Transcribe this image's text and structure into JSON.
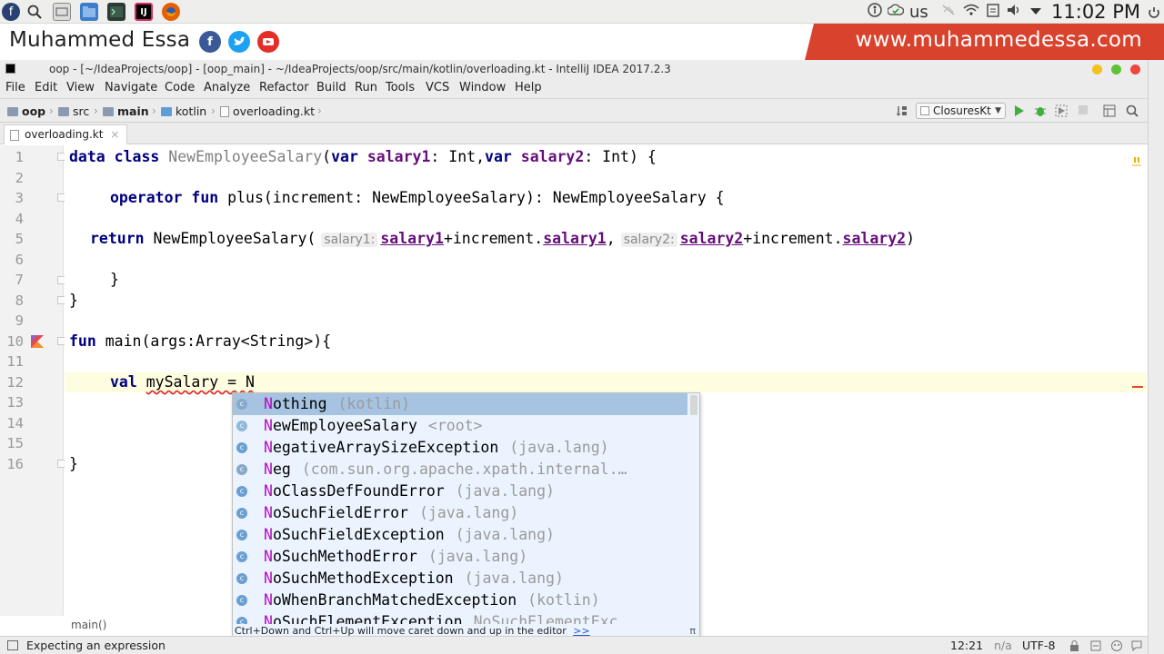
{
  "taskbar": {
    "keyboard_layout": "us",
    "clock": "11:02 PM",
    "launcher_icons": [
      "fedora-icon",
      "search-icon",
      "show-desktop-icon",
      "files-icon",
      "terminal-icon",
      "intellij-icon",
      "firefox-icon"
    ]
  },
  "banner": {
    "name": "Muhammed Essa",
    "website": "www.muhammedessa.com",
    "social": [
      "facebook-icon",
      "twitter-icon",
      "youtube-icon"
    ],
    "colors": {
      "accent": "#d9422d",
      "facebook": "#3b5998",
      "twitter": "#1da1f2",
      "youtube": "#e52d27"
    }
  },
  "window": {
    "title": "oop - [~/IdeaProjects/oop] - [oop_main] - ~/IdeaProjects/oop/src/main/kotlin/overloading.kt - IntelliJ IDEA 2017.2.3"
  },
  "menu": [
    "File",
    "Edit",
    "View",
    "Navigate",
    "Code",
    "Analyze",
    "Refactor",
    "Build",
    "Run",
    "Tools",
    "VCS",
    "Window",
    "Help"
  ],
  "breadcrumbs": [
    "oop",
    "src",
    "main",
    "kotlin",
    "overloading.kt"
  ],
  "run_config": "ClosuresKt",
  "tab": {
    "label": "overloading.kt",
    "close": "×"
  },
  "line_numbers": [
    "1",
    "2",
    "3",
    "4",
    "5",
    "6",
    "7",
    "8",
    "9",
    "10",
    "11",
    "12",
    "13",
    "14",
    "15",
    "16"
  ],
  "code": {
    "l1": {
      "kw1": "data class ",
      "name": "NewEmployeeSalary",
      "p1": "(",
      "kw2": "var ",
      "prop1": "salary1",
      "t1": ": Int,",
      "kw3": "var ",
      "prop2": "salary2",
      "t2": ": Int) {"
    },
    "l3": {
      "kw": "operator fun ",
      "rest": "plus(increment: NewEmployeeSalary): NewEmployeeSalary {"
    },
    "l5": {
      "kw": "return ",
      "call": "NewEmployeeSalary(",
      "hint1": "salary1:",
      "a1": "salary1",
      "a2": "+increment.",
      "a3": "salary1",
      "a4": ",",
      "hint2": "salary2:",
      "b1": "salary2",
      "b2": "+increment.",
      "b3": "salary2",
      "end": ")"
    },
    "l7": "}",
    "l8": "}",
    "l10": {
      "kw": "fun ",
      "rest": "main(args:Array<String>){"
    },
    "l12": {
      "kw": "val ",
      "rest": "mySalary = N"
    },
    "l16": "}"
  },
  "completion": {
    "items": [
      {
        "match": "N",
        "rest": "othing",
        "loc": "(kotlin)",
        "icon": "class-icon"
      },
      {
        "match": "N",
        "rest": "ewEmployeeSalary",
        "loc": "<root>",
        "icon": "class-icon"
      },
      {
        "match": "N",
        "rest": "egativeArraySizeException",
        "loc": "(java.lang)",
        "icon": "class-icon"
      },
      {
        "match": "N",
        "rest": "eg",
        "loc": "(com.sun.org.apache.xpath.internal.…",
        "icon": "class-icon"
      },
      {
        "match": "N",
        "rest": "oClassDefFoundError",
        "loc": "(java.lang)",
        "icon": "class-icon"
      },
      {
        "match": "N",
        "rest": "oSuchFieldError",
        "loc": "(java.lang)",
        "icon": "class-icon"
      },
      {
        "match": "N",
        "rest": "oSuchFieldException",
        "loc": "(java.lang)",
        "icon": "class-icon"
      },
      {
        "match": "N",
        "rest": "oSuchMethodError",
        "loc": "(java.lang)",
        "icon": "class-icon"
      },
      {
        "match": "N",
        "rest": "oSuchMethodException",
        "loc": "(java.lang)",
        "icon": "class-icon"
      },
      {
        "match": "N",
        "rest": "oWhenBranchMatchedException",
        "loc": "(kotlin)",
        "icon": "class-icon"
      },
      {
        "match": "N",
        "rest": "oSuchElementException",
        "loc": "NoSuchElementExc",
        "icon": "class-icon"
      }
    ],
    "footer": "Ctrl+Down and Ctrl+Up will move caret down and up in the editor",
    "footer_link": ">>",
    "pi": "π"
  },
  "editor_breadcrumb": "main()",
  "status": {
    "message": "Expecting an expression",
    "position": "12:21",
    "na": "n/a",
    "encoding": "UTF-8 "
  }
}
